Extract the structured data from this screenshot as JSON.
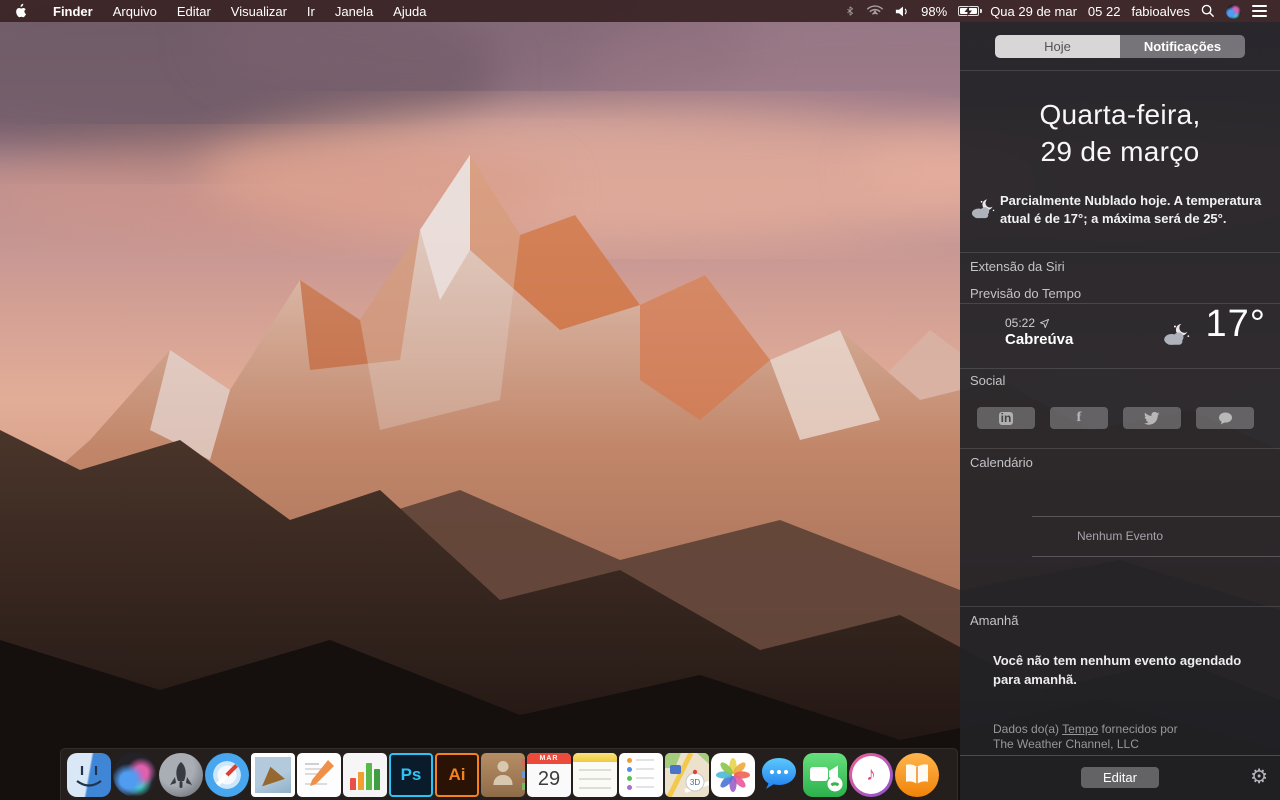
{
  "menu_bar": {
    "items": [
      "Finder",
      "Arquivo",
      "Editar",
      "Visualizar",
      "Ir",
      "Janela",
      "Ajuda"
    ],
    "status": {
      "battery_percent": "98%",
      "date": "Qua 29 de mar",
      "time": "05 22",
      "username": "fabioalves"
    }
  },
  "panel": {
    "tabs": {
      "today": "Hoje",
      "notifications": "Notificações"
    },
    "date_line1": "Quarta-feira,",
    "date_line2": "29 de março",
    "weather_summary": "Parcialmente Nublado hoje. A temperatura atual é de 17°; a máxima será de 25°.",
    "siri_section": "Extensão da Siri",
    "weather_section": "Previsão do Tempo",
    "weather_widget": {
      "time": "05:22",
      "location": "Cabreúva",
      "temperature": "17°"
    },
    "social_section": "Social",
    "social": {
      "linkedin_glyph": "in",
      "facebook_glyph": "f"
    },
    "calendar_section": "Calendário",
    "calendar_empty": "Nenhum Evento",
    "tomorrow_section": "Amanhã",
    "tomorrow_text": "Você não tem nenhum evento agendado para amanhã.",
    "footer": {
      "prefix": "Dados do(a) ",
      "link": "Tempo",
      "suffix": " fornecidos por",
      "line2": "The Weather Channel, LLC"
    },
    "edit_button": "Editar"
  },
  "dock": {
    "photoshop_label": "Ps",
    "illustrator_label": "Ai",
    "calendar_month": "MAR",
    "calendar_day": "29",
    "maps_3d": "3D"
  },
  "icons": {
    "gear": "⚙",
    "itunes_note": "♪"
  },
  "colors": {
    "menu_bar_bg": "#3a2425",
    "panel_bg": "#212126",
    "tab_selected_bg": "#d8d6d7",
    "messages_blue": "#2f86f2",
    "calendar_red": "#ec4b3c",
    "photoshop_cyan": "#2dc4f5",
    "illustrator_orange": "#f5821e"
  }
}
